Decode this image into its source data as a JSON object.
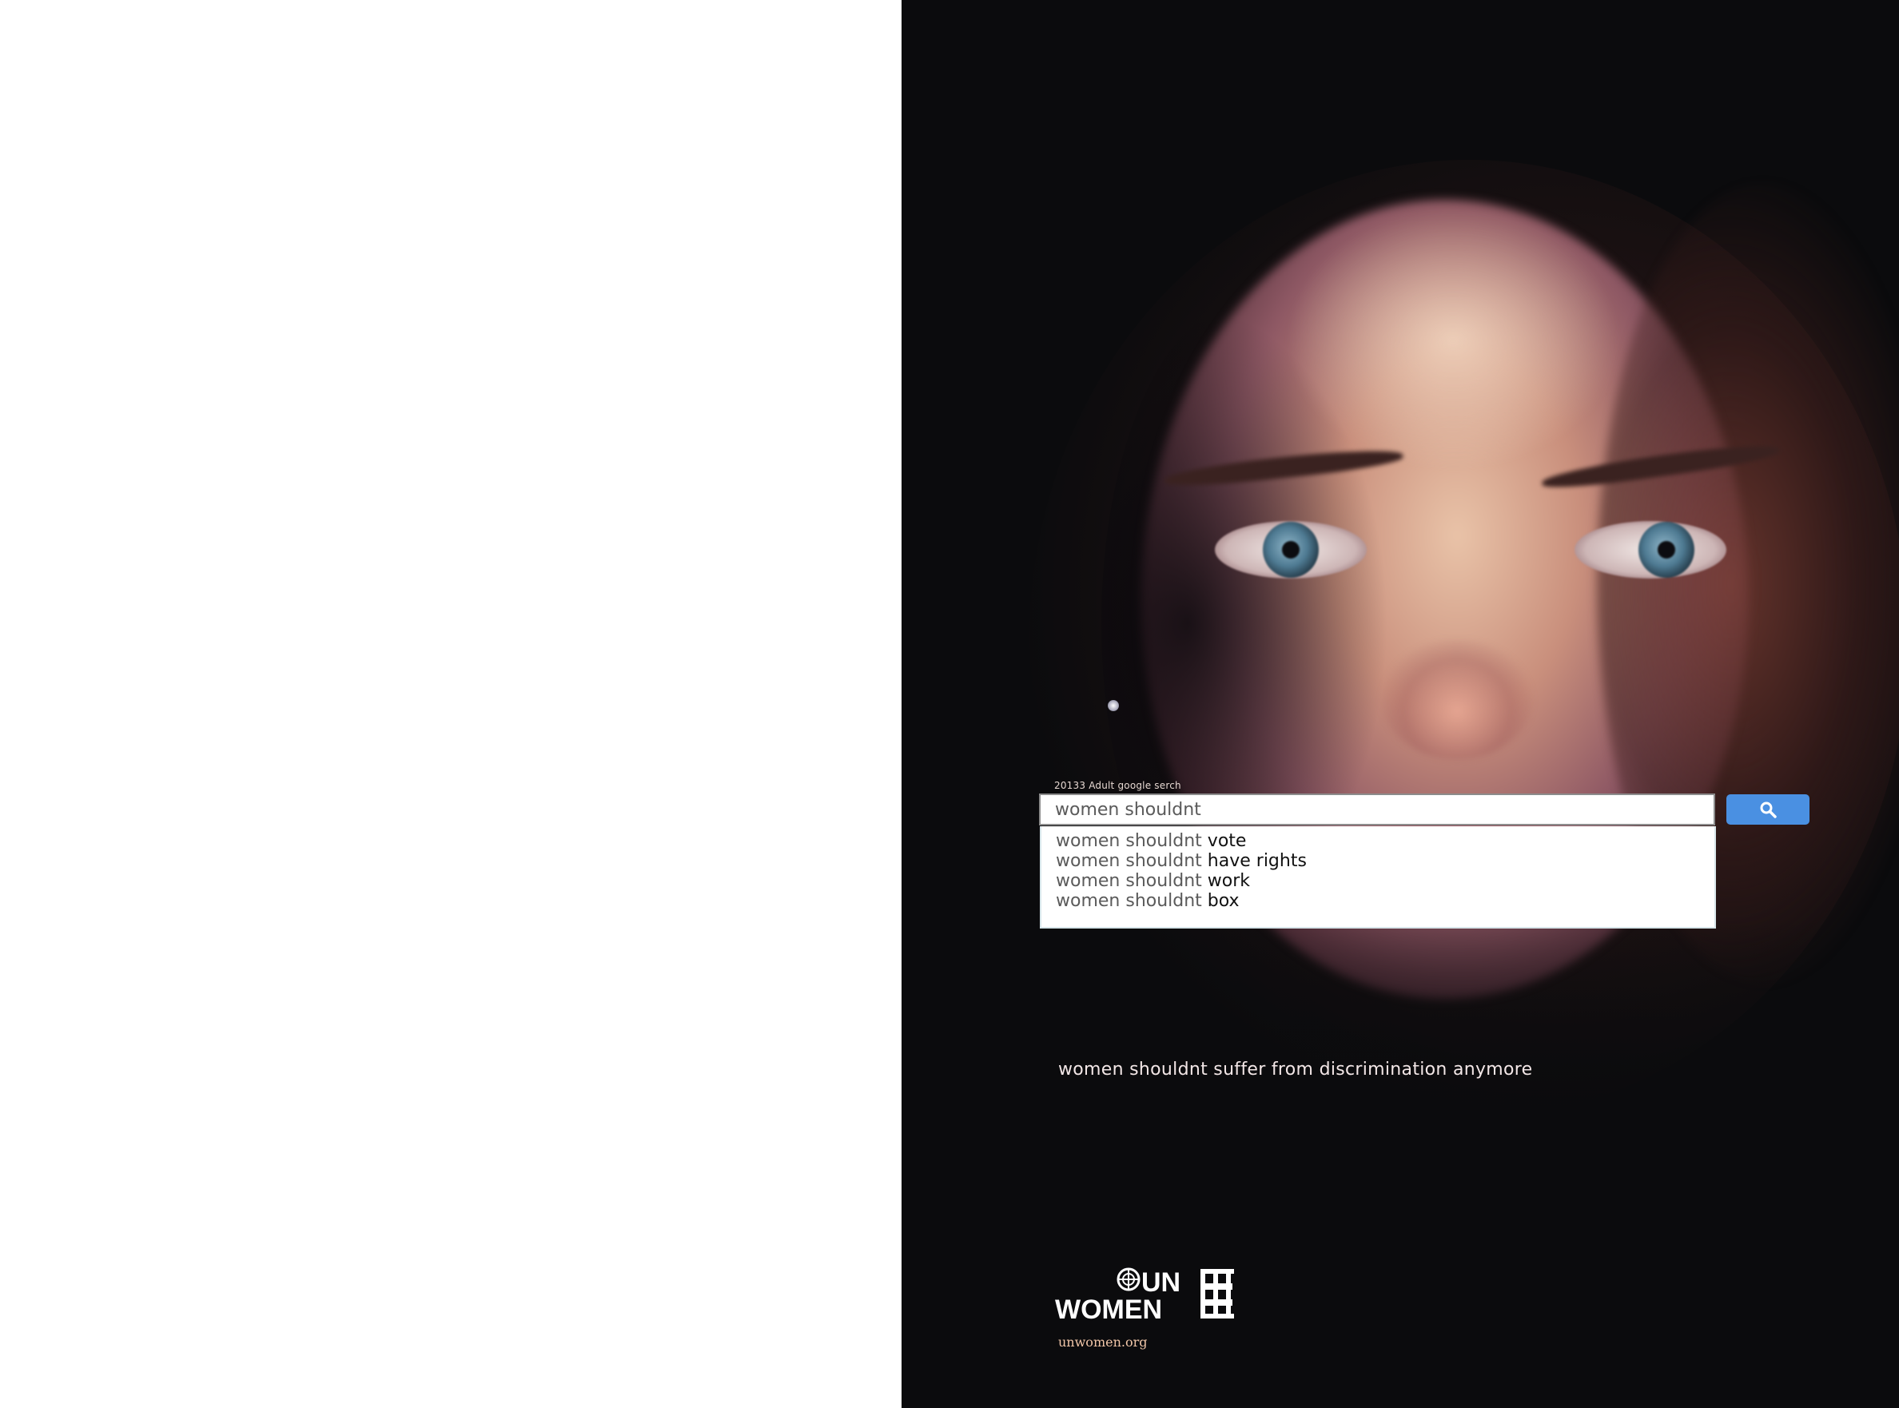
{
  "search": {
    "caption": "20133 Adult google serch",
    "query": "women shouldnt",
    "button_icon": "search-icon",
    "suggestions": [
      {
        "prefix": "women shouldnt",
        "completion": " vote"
      },
      {
        "prefix": "women shouldnt",
        "completion": " have rights"
      },
      {
        "prefix": "women shouldnt",
        "completion": " work"
      },
      {
        "prefix": "women shouldnt",
        "completion": " box"
      }
    ]
  },
  "tagline": "women shouldnt suffer from discrimination anymore",
  "logo": {
    "line1": "UN",
    "line2": "WOMEN",
    "url": "unwomen.org"
  },
  "colors": {
    "poster_background": "#0b0b0d",
    "search_button": "#4a90e2",
    "url_text": "#f1c6a8"
  }
}
